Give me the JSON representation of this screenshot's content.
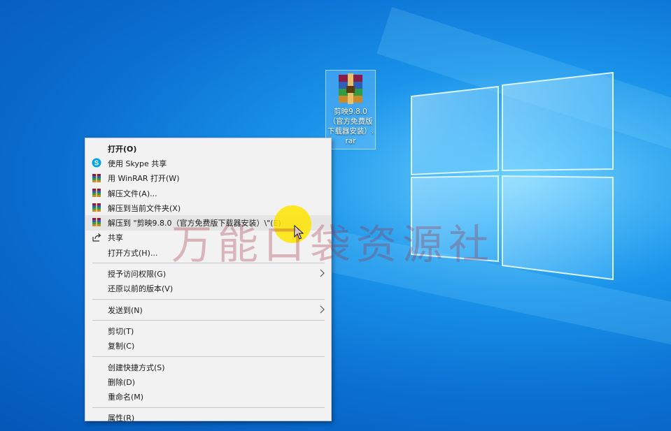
{
  "desktop_icon": {
    "label": "剪映9.8.0（官方免费版下载器安装）.rar"
  },
  "context_menu": {
    "items": [
      {
        "label": "打开(O)",
        "icon": "",
        "bold": true
      },
      {
        "label": "使用 Skype 共享",
        "icon": "skype-icon"
      },
      {
        "label": "用 WinRAR 打开(W)",
        "icon": "winrar-icon"
      },
      {
        "label": "解压文件(A)...",
        "icon": "winrar-icon"
      },
      {
        "label": "解压到当前文件夹(X)",
        "icon": "winrar-icon"
      },
      {
        "label": "解压到 \"剪映9.8.0（官方免费版下载器安装）\\\"(E)",
        "icon": "winrar-icon",
        "highlighted": true
      },
      {
        "label": "共享",
        "icon": "share-icon"
      },
      {
        "label": "打开方式(H)...",
        "icon": ""
      },
      {
        "label": "授予访问权限(G)",
        "icon": "",
        "submenu": true
      },
      {
        "label": "还原以前的版本(V)",
        "icon": ""
      },
      {
        "label": "发送到(N)",
        "icon": "",
        "submenu": true
      },
      {
        "label": "剪切(T)",
        "icon": ""
      },
      {
        "label": "复制(C)",
        "icon": ""
      },
      {
        "label": "创建快捷方式(S)",
        "icon": ""
      },
      {
        "label": "删除(D)",
        "icon": ""
      },
      {
        "label": "重命名(M)",
        "icon": ""
      },
      {
        "label": "属性(R)",
        "icon": ""
      }
    ]
  },
  "watermark": "万能口袋资源社",
  "colors": {
    "desktop_blue": "#0a6fd1",
    "menu_bg": "#f2f2f2",
    "cursor_highlight": "#ffe400"
  }
}
